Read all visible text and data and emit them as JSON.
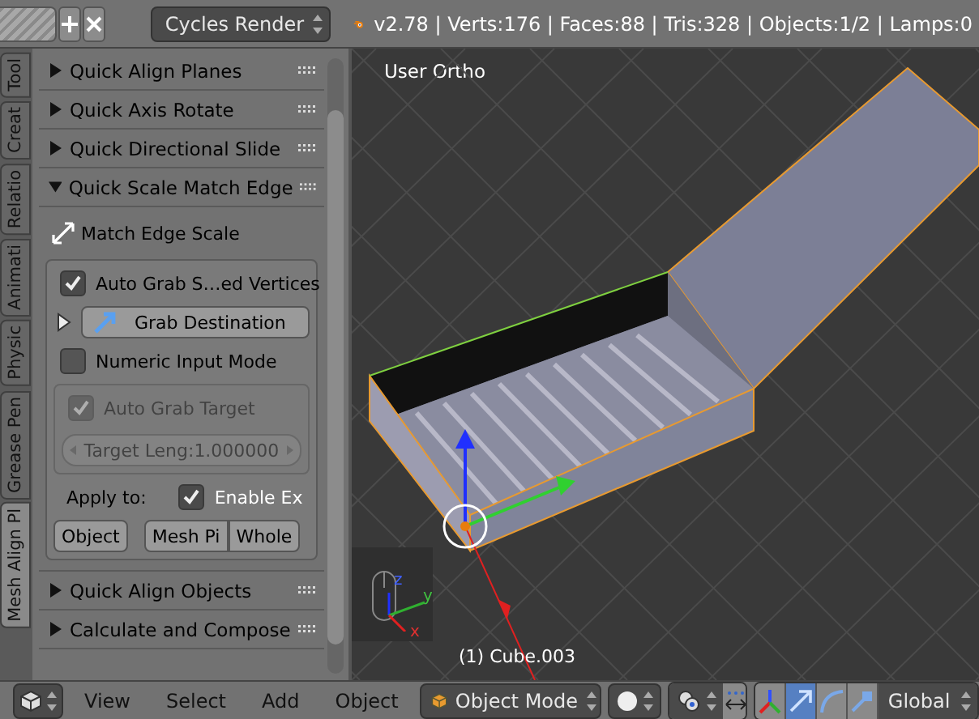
{
  "header": {
    "render_engine": "Cycles Render",
    "stats": "v2.78 | Verts:176 | Faces:88 | Tris:328 | Objects:1/2 | Lamps:0"
  },
  "side_tabs": [
    {
      "label": "Tool",
      "selected": false
    },
    {
      "label": "Creat",
      "selected": false
    },
    {
      "label": "Relatio",
      "selected": false
    },
    {
      "label": "Animati",
      "selected": false
    },
    {
      "label": "Physic",
      "selected": false
    },
    {
      "label": "Grease Pen",
      "selected": false
    },
    {
      "label": "Mesh Align Pl",
      "selected": true
    }
  ],
  "panels": [
    {
      "title": "Quick Align Planes",
      "expanded": false
    },
    {
      "title": "Quick Axis Rotate",
      "expanded": false
    },
    {
      "title": "Quick Directional Slide",
      "expanded": false
    },
    {
      "title": "Quick Scale Match Edge",
      "expanded": true,
      "content": {
        "operator": "Match Edge Scale",
        "auto_grab": {
          "label": "Auto Grab S…ed Vertices",
          "checked": true
        },
        "grab_destination": {
          "label": "Grab Destination",
          "expanded": false
        },
        "numeric_input": {
          "label": "Numeric Input Mode",
          "checked": false
        },
        "auto_grab_target": {
          "label": "Auto Grab Target",
          "checked": true,
          "disabled": true
        },
        "target_length": {
          "label": "Target Leng:",
          "value": "1.000000",
          "disabled": true
        },
        "apply_label": "Apply to:",
        "enable_ex": {
          "label": "Enable Ex",
          "checked": true
        },
        "apply_buttons": [
          "Object",
          "Mesh Pi",
          "Whole"
        ]
      }
    },
    {
      "title": "Quick Align Objects",
      "expanded": false
    },
    {
      "title": "Calculate and Compose",
      "expanded": false
    }
  ],
  "viewport": {
    "view_name": "User Ortho",
    "object_label": "(1) Cube.003",
    "axis_labels": [
      "x",
      "y",
      "z"
    ]
  },
  "bottom_bar": {
    "menus": [
      "View",
      "Select",
      "Add",
      "Object"
    ],
    "mode": "Object Mode",
    "manipulators": [
      {
        "kind": "axes",
        "selected": false
      },
      {
        "kind": "translate",
        "selected": true
      },
      {
        "kind": "rotate",
        "selected": false
      },
      {
        "kind": "scale",
        "selected": false
      }
    ],
    "orientation": "Global"
  }
}
